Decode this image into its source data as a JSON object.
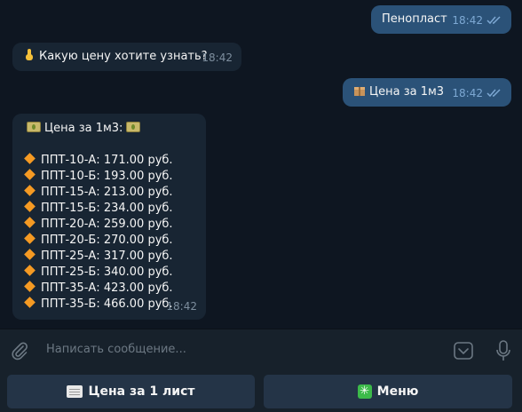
{
  "messages": [
    {
      "id": "m1",
      "direction": "out",
      "text": "Пенопласт",
      "time": "18:42"
    },
    {
      "id": "m2",
      "direction": "in",
      "text": "Какую цену хотите узнать?",
      "time": "18:42"
    },
    {
      "id": "m3",
      "direction": "out",
      "text": "Цена за 1м3",
      "time": "18:42"
    },
    {
      "id": "m4",
      "direction": "in",
      "title": "Цена за 1м3:",
      "time": "18:42",
      "prices": [
        "ППТ-10-А: 171.00 руб.",
        "ППТ-10-Б: 193.00 руб.",
        "ППТ-15-А: 213.00 руб.",
        "ППТ-15-Б: 234.00 руб.",
        "ППТ-20-А: 259.00 руб.",
        "ППТ-20-Б: 270.00 руб.",
        "ППТ-25-А: 317.00 руб.",
        "ППТ-25-Б: 340.00 руб.",
        "ППТ-35-А: 423.00 руб.",
        "ППТ-35-Б: 466.00 руб."
      ]
    }
  ],
  "input": {
    "placeholder": "Написать сообщение..."
  },
  "keyboard": {
    "button1": "Цена за 1 лист",
    "button2": "Меню"
  },
  "icons": {
    "attach": "paperclip-icon",
    "keyboard": "keyboard-toggle-icon",
    "mic": "microphone-icon",
    "m2_emoji": "pointing-down-hand-icon",
    "m3_emoji": "package-icon",
    "m4_emoji": "money-banknote-icon",
    "bullet": "orange-diamond-icon",
    "button1_emoji": "page-icon",
    "button2_emoji": "sparkle-icon"
  },
  "colors": {
    "background": "#0e1621",
    "outgoing": "#2b5278",
    "incoming": "#182533",
    "panel": "#17212b",
    "button": "#243447"
  }
}
